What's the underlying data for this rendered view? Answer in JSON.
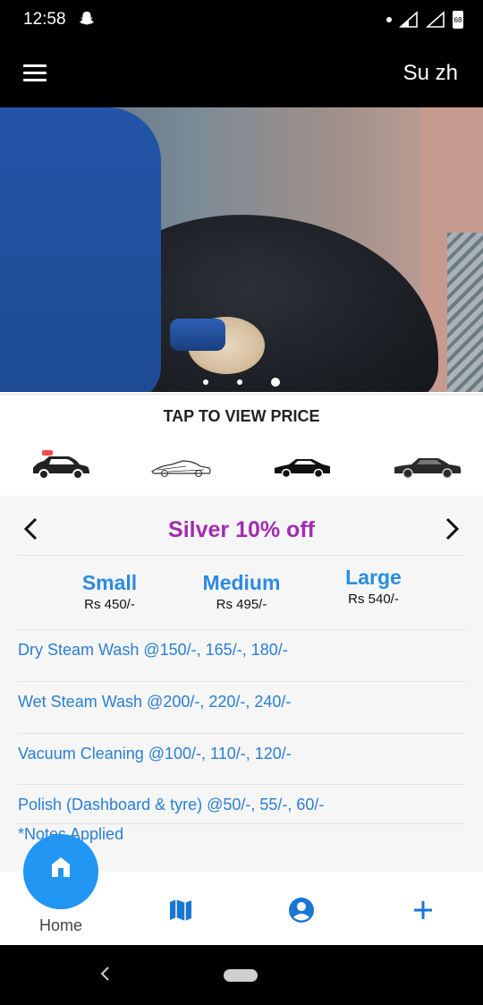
{
  "status_bar": {
    "time": "12:58",
    "battery": "68"
  },
  "header": {
    "user_name": "Su zh"
  },
  "banner": {
    "active_slide_index": 3,
    "slide_count": 3
  },
  "tap_to_view": "TAP TO VIEW PRICE",
  "car_types": [
    "hatchback-icon",
    "sports-car-icon",
    "sedan-icon",
    "luxury-sedan-icon"
  ],
  "plan": {
    "title": "Silver 10% off"
  },
  "sizes": [
    {
      "name": "Small",
      "price": "Rs 450/-"
    },
    {
      "name": "Medium",
      "price": "Rs 495/-"
    },
    {
      "name": "Large",
      "price": "Rs 540/-"
    }
  ],
  "services": [
    "Dry Steam Wash @150/-, 165/-, 180/-",
    "Wet Steam Wash @200/-, 220/-, 240/-",
    "Vacuum Cleaning @100/-, 110/-, 120/-",
    "Polish (Dashboard & tyre) @50/-, 55/-, 60/-"
  ],
  "notes": "*Notes Applied",
  "bottom_nav": {
    "home_label": "Home"
  },
  "colors": {
    "accent_blue": "#2196f3",
    "plan_purple": "#a22cb1",
    "link_blue": "#2a7fd4"
  }
}
